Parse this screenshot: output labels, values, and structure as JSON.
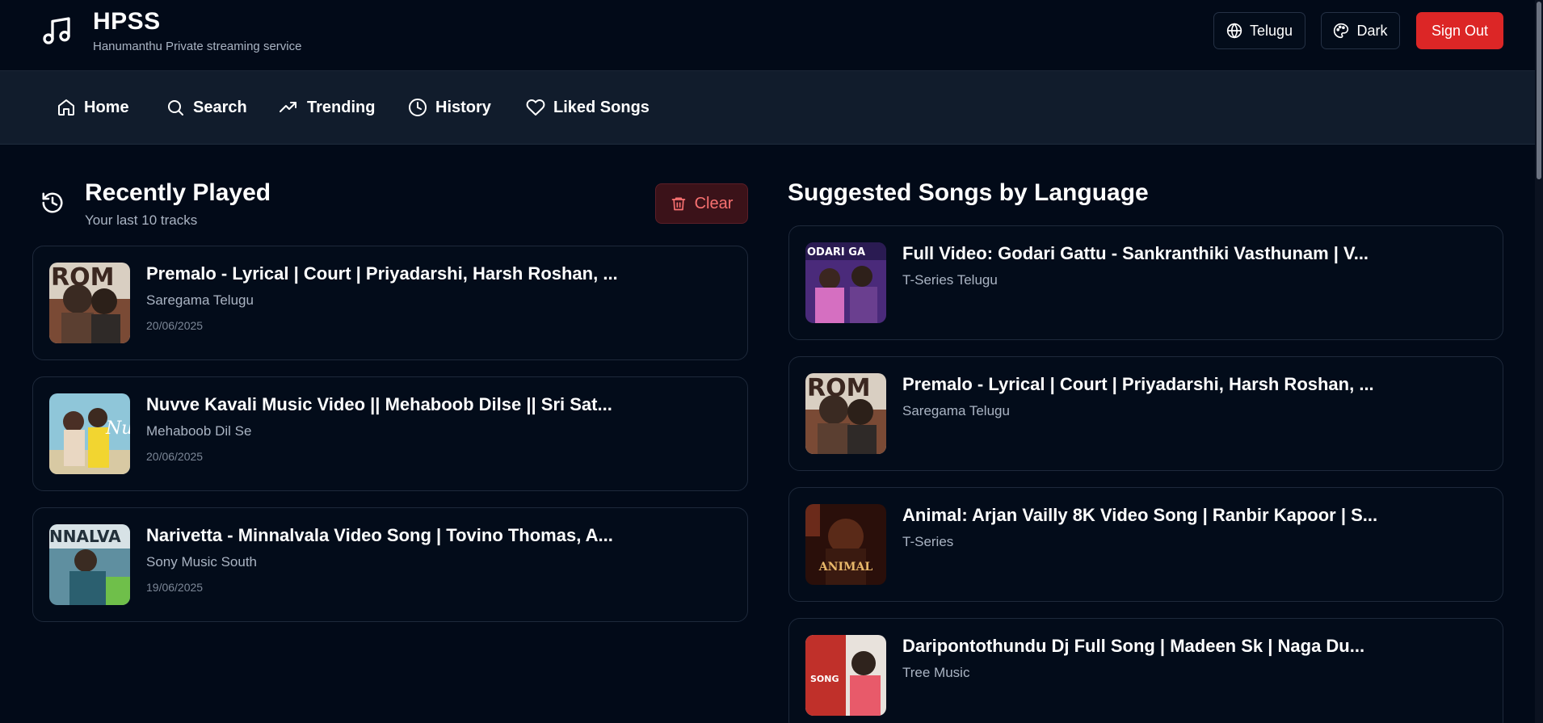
{
  "header": {
    "title": "HPSS",
    "subtitle": "Hanumanthu Private streaming service",
    "language_label": "Telugu",
    "theme_label": "Dark",
    "signout_label": "Sign Out"
  },
  "nav": {
    "items": [
      {
        "label": "Home",
        "icon": "home-icon"
      },
      {
        "label": "Search",
        "icon": "search-icon"
      },
      {
        "label": "Trending",
        "icon": "trending-up-icon"
      },
      {
        "label": "History",
        "icon": "clock-icon"
      },
      {
        "label": "Liked Songs",
        "icon": "heart-icon"
      }
    ]
  },
  "recently_played": {
    "title": "Recently Played",
    "subtitle": "Your last 10 tracks",
    "clear_label": "Clear",
    "tracks": [
      {
        "title": "Premalo - Lyrical | Court | Priyadarshi, Harsh Roshan, ...",
        "artist": "Saregama Telugu",
        "date": "20/06/2025"
      },
      {
        "title": "Nuvve Kavali Music Video || Mehaboob Dilse || Sri Sat...",
        "artist": "Mehaboob Dil Se",
        "date": "20/06/2025"
      },
      {
        "title": "Narivetta - Minnalvala Video Song | Tovino Thomas, A...",
        "artist": "Sony Music South",
        "date": "19/06/2025"
      }
    ]
  },
  "suggested": {
    "title": "Suggested Songs by Language",
    "tracks": [
      {
        "title": "Full Video: Godari Gattu - Sankranthiki Vasthunam | V...",
        "artist": "T-Series Telugu"
      },
      {
        "title": "Premalo - Lyrical | Court | Priyadarshi, Harsh Roshan, ...",
        "artist": "Saregama Telugu"
      },
      {
        "title": "Animal: Arjan Vailly 8K Video Song | Ranbir Kapoor | S...",
        "artist": "T-Series"
      },
      {
        "title": "Daripontothundu Dj Full Song | Madeen Sk | Naga Du...",
        "artist": "Tree Music"
      }
    ]
  },
  "thumbnail_text": {
    "premalo": "ROM",
    "nuvve": "Nu",
    "narivetta": "NNALVA",
    "godari": "ODARI GA",
    "animal": "ANIMAL",
    "daripon": "SONG"
  },
  "colors": {
    "background": "#020a18",
    "nav_background": "#111c2c",
    "accent_red": "#dc2626",
    "clear_text": "#f87171"
  }
}
